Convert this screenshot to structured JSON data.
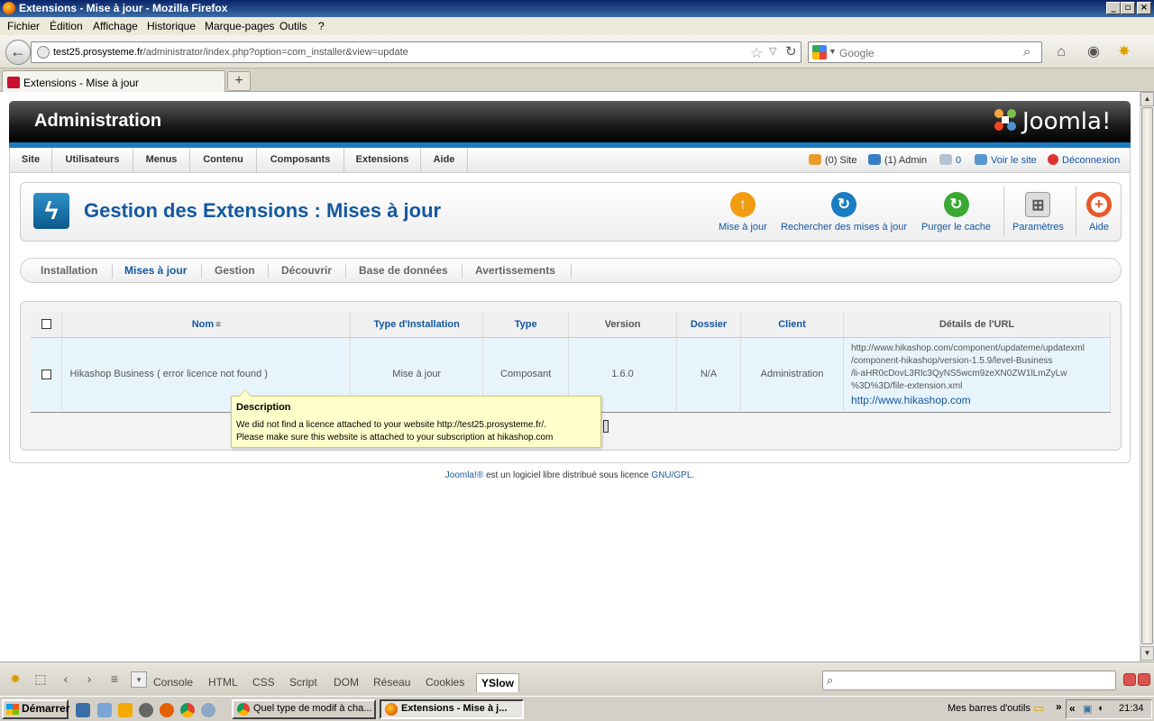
{
  "window": {
    "title": "Extensions - Mise à jour - Mozilla Firefox"
  },
  "menubar": {
    "items": [
      "Fichier",
      "Édition",
      "Affichage",
      "Historique",
      "Marque-pages",
      "Outils",
      "?"
    ]
  },
  "navbar": {
    "url_domain": "test25.prosysteme.fr",
    "url_path": "/administrator/index.php?option=com_installer&view=update",
    "search_placeholder": "Google"
  },
  "tabs": [
    {
      "label": "Extensions - Mise à jour"
    }
  ],
  "joomla": {
    "header_title": "Administration",
    "logo_text": "Joomla!",
    "menu": [
      "Site",
      "Utilisateurs",
      "Menus",
      "Contenu",
      "Composants",
      "Extensions",
      "Aide"
    ],
    "status": {
      "site": "(0) Site",
      "admin": "(1) Admin",
      "messages": "0",
      "view_site": "Voir le site",
      "logout": "Déconnexion"
    },
    "page_title": "Gestion des Extensions : Mises à jour",
    "toolbar": [
      {
        "label": "Mise à jour",
        "icon": "arrow-up-icon",
        "color": "#f39c12"
      },
      {
        "label": "Rechercher des mises à jour",
        "icon": "refresh-icon",
        "color": "#1b7cc1"
      },
      {
        "label": "Purger le cache",
        "icon": "purge-icon",
        "color": "#3aa832"
      },
      {
        "label": "Paramètres",
        "icon": "params-icon",
        "color": "#888888"
      },
      {
        "label": "Aide",
        "icon": "lifebuoy-icon",
        "color": "#e8582a"
      }
    ],
    "subnav": [
      "Installation",
      "Mises à jour",
      "Gestion",
      "Découvrir",
      "Base de données",
      "Avertissements"
    ],
    "subnav_active": "Mises à jour",
    "table": {
      "headers": [
        "Nom",
        "Type d'Installation",
        "Type",
        "Version",
        "Dossier",
        "Client",
        "Détails de l'URL"
      ],
      "rows": [
        {
          "name": "Hikashop Business ( error licence not found )",
          "install_type": "Mise à jour",
          "type": "Composant",
          "version": "1.6.0",
          "folder": "N/A",
          "client": "Administration",
          "details_lines": [
            "http://www.hikashop.com/component/updateme/updatexml",
            "/component-hikashop/version-1.5.9/level-Business",
            "/li-aHR0cDovL3Rlc3QyNS5wcm9zeXN0ZW1lLmZyLw",
            "%3D%3D/file-extension.xml"
          ],
          "details_link": "http://www.hikashop.com"
        }
      ]
    },
    "tooltip": {
      "title": "Description",
      "line1": "We did not find a licence attached to your website http://test25.prosysteme.fr/.",
      "line2": "Please make sure this website is attached to your subscription at hikashop.com"
    },
    "footer": {
      "joomla": "Joomla!®",
      "text": " est un logiciel libre distribué sous licence ",
      "license": "GNU/GPL",
      "end": "."
    }
  },
  "firebug": {
    "tabs": [
      "Console",
      "HTML",
      "CSS",
      "Script",
      "DOM",
      "Réseau",
      "Cookies",
      "YSlow"
    ],
    "active": "YSlow"
  },
  "taskbar": {
    "start": "Démarrer",
    "tasks": [
      {
        "label": "Quel type de modif à cha...",
        "active": false
      },
      {
        "label": "Extensions - Mise à j...",
        "active": true
      }
    ],
    "toolbar_label": "Mes barres d'outils",
    "clock": "21:34"
  }
}
